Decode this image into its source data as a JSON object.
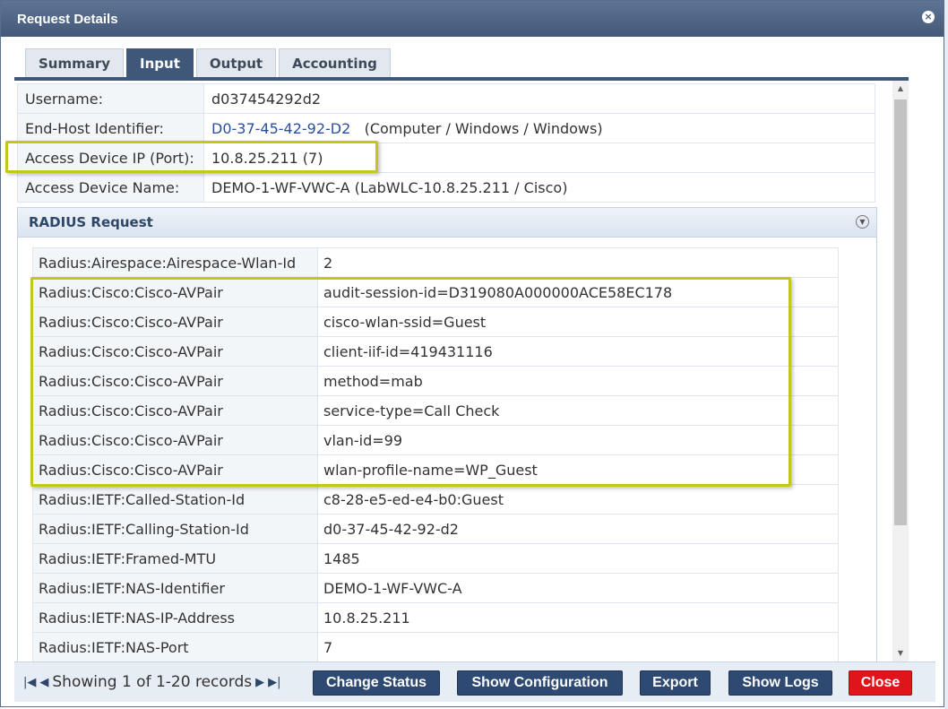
{
  "dialog": {
    "title": "Request Details",
    "close_symbol": "×"
  },
  "tabs": [
    {
      "label": "Summary",
      "active": false
    },
    {
      "label": "Input",
      "active": true
    },
    {
      "label": "Output",
      "active": false
    },
    {
      "label": "Accounting",
      "active": false
    }
  ],
  "summary": {
    "username_label": "Username:",
    "username": "d037454292d2",
    "endhost_label": "End-Host Identifier:",
    "endhost_link": "D0-37-45-42-92-D2",
    "endhost_desc": "(Computer / Windows / Windows)",
    "access_ip_label": "Access Device IP (Port):",
    "access_ip": "10.8.25.211 (7)",
    "access_name_label": "Access Device Name:",
    "access_name": "DEMO-1-WF-VWC-A (LabWLC-10.8.25.211 / Cisco)"
  },
  "radius": {
    "header": "RADIUS Request",
    "rows": [
      {
        "attr": "Radius:Airespace:Airespace-Wlan-Id",
        "value": "2"
      },
      {
        "attr": "Radius:Cisco:Cisco-AVPair",
        "value": "audit-session-id=D319080A000000ACE58EC178"
      },
      {
        "attr": "Radius:Cisco:Cisco-AVPair",
        "value": "cisco-wlan-ssid=Guest"
      },
      {
        "attr": "Radius:Cisco:Cisco-AVPair",
        "value": "client-iif-id=419431116"
      },
      {
        "attr": "Radius:Cisco:Cisco-AVPair",
        "value": "method=mab"
      },
      {
        "attr": "Radius:Cisco:Cisco-AVPair",
        "value": "service-type=Call Check"
      },
      {
        "attr": "Radius:Cisco:Cisco-AVPair",
        "value": "vlan-id=99"
      },
      {
        "attr": "Radius:Cisco:Cisco-AVPair",
        "value": "wlan-profile-name=WP_Guest"
      },
      {
        "attr": "Radius:IETF:Called-Station-Id",
        "value": "c8-28-e5-ed-e4-b0:Guest"
      },
      {
        "attr": "Radius:IETF:Calling-Station-Id",
        "value": "d0-37-45-42-92-d2"
      },
      {
        "attr": "Radius:IETF:Framed-MTU",
        "value": "1485"
      },
      {
        "attr": "Radius:IETF:NAS-Identifier",
        "value": "DEMO-1-WF-VWC-A"
      },
      {
        "attr": "Radius:IETF:NAS-IP-Address",
        "value": "10.8.25.211"
      },
      {
        "attr": "Radius:IETF:NAS-Port",
        "value": "7"
      }
    ]
  },
  "footer": {
    "first_symbol": "|◀",
    "prev_symbol": "◀",
    "status": "Showing 1 of 1-20 records",
    "next_symbol": "▶",
    "last_symbol": "▶|",
    "buttons": {
      "change_status": "Change Status",
      "show_configuration": "Show Configuration",
      "export": "Export",
      "show_logs": "Show Logs",
      "close": "Close"
    }
  },
  "colors": {
    "titlebar": "#4b6183",
    "active_tab": "#3f5779",
    "highlight": "#c3c71c",
    "close_button": "#e0141b",
    "action_button": "#2f4a72",
    "link": "#2a4f9e"
  }
}
